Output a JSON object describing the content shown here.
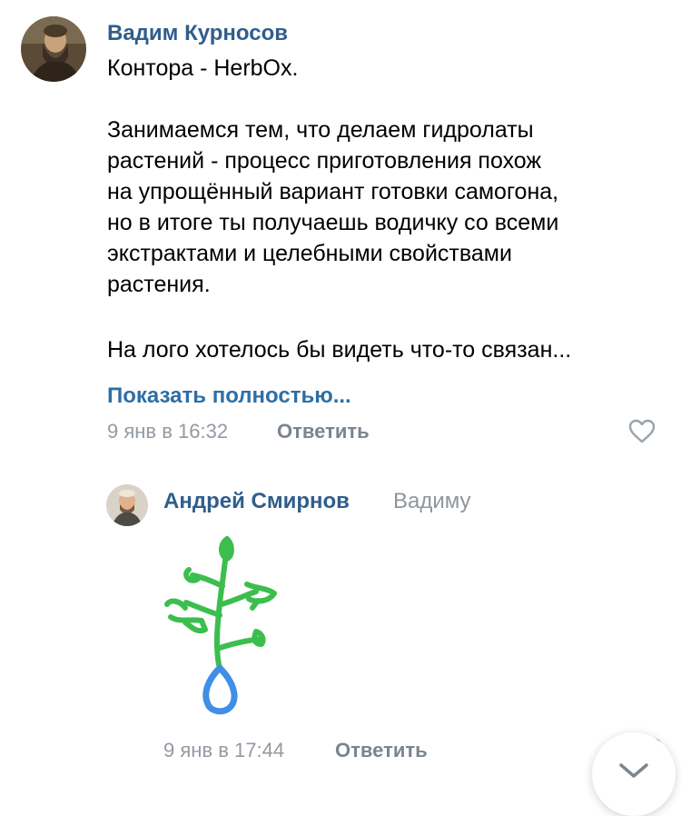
{
  "comment": {
    "author": "Вадим Курносов",
    "lines": [
      "Контора - HerbOx.",
      "",
      "Занимаемся тем, что делаем гидролаты",
      "растений - процесс приготовления похож",
      "на упрощённый вариант готовки самогона,",
      "но в итоге ты получаешь водичку со всеми",
      "экстрактами и целебными свойствами",
      "растения.",
      "",
      "На лого хотелось бы видеть что-то связан..."
    ],
    "show_more": "Показать полностью...",
    "time": "9 янв в 16:32",
    "reply_label": "Ответить",
    "like_icon": "heart-outline-icon"
  },
  "reply": {
    "author": "Андрей Смирнов",
    "reply_to": "Вадиму",
    "attachment_icon": "plant-drawing",
    "time": "9 янв в 17:44",
    "reply_label": "Ответить"
  },
  "scroll_button_icon": "chevron-down-icon",
  "colors": {
    "author": "#2f5e8c",
    "link": "#2f6ea5",
    "meta": "#929aa3",
    "drawing_green": "#3cbe4e",
    "drawing_blue": "#3f8fe6"
  }
}
